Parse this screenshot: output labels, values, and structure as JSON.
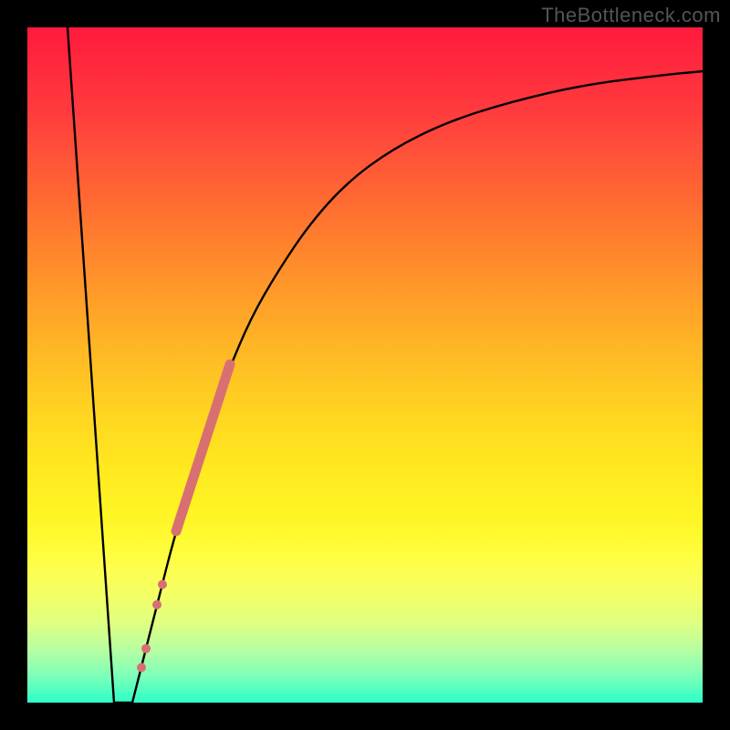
{
  "watermark": "TheBottleneck.com",
  "chart_data": {
    "type": "line",
    "title": "",
    "xlabel": "",
    "ylabel": "",
    "x_range": [
      0,
      740
    ],
    "y_range_pct": [
      0,
      100
    ],
    "note": "Black curve: bottleneck % vs component score. X units unlabeled (0–740 px). Y: 0% at bottom (green), 100% at top (red).",
    "curve": {
      "descent": [
        {
          "x": 44,
          "y_pct": 100
        },
        {
          "x": 95,
          "y_pct": 0
        }
      ],
      "flat": [
        {
          "x": 95,
          "y_pct": 0
        },
        {
          "x": 115,
          "y_pct": 0
        }
      ],
      "ascent": [
        {
          "x": 115,
          "y_pct": 0
        },
        {
          "x": 130,
          "y_pct": 8
        },
        {
          "x": 145,
          "y_pct": 16
        },
        {
          "x": 160,
          "y_pct": 24
        },
        {
          "x": 180,
          "y_pct": 33
        },
        {
          "x": 200,
          "y_pct": 42
        },
        {
          "x": 220,
          "y_pct": 49
        },
        {
          "x": 245,
          "y_pct": 57
        },
        {
          "x": 275,
          "y_pct": 64
        },
        {
          "x": 310,
          "y_pct": 71
        },
        {
          "x": 350,
          "y_pct": 77
        },
        {
          "x": 400,
          "y_pct": 82
        },
        {
          "x": 460,
          "y_pct": 86
        },
        {
          "x": 530,
          "y_pct": 89
        },
        {
          "x": 610,
          "y_pct": 91.5
        },
        {
          "x": 700,
          "y_pct": 93
        },
        {
          "x": 740,
          "y_pct": 93.5
        }
      ]
    },
    "markers": {
      "color": "#d87072",
      "cluster_segment": {
        "x0": 163,
        "y0_pct": 25.4,
        "x1": 222,
        "y1_pct": 50.1,
        "width": 11
      },
      "points": [
        {
          "x": 142,
          "y_pct": 14.5,
          "r": 5
        },
        {
          "x": 148,
          "y_pct": 17.5,
          "r": 5
        },
        {
          "x": 125,
          "y_pct": 5.2,
          "r": 5
        },
        {
          "x": 130,
          "y_pct": 8.0,
          "r": 5
        }
      ]
    }
  }
}
